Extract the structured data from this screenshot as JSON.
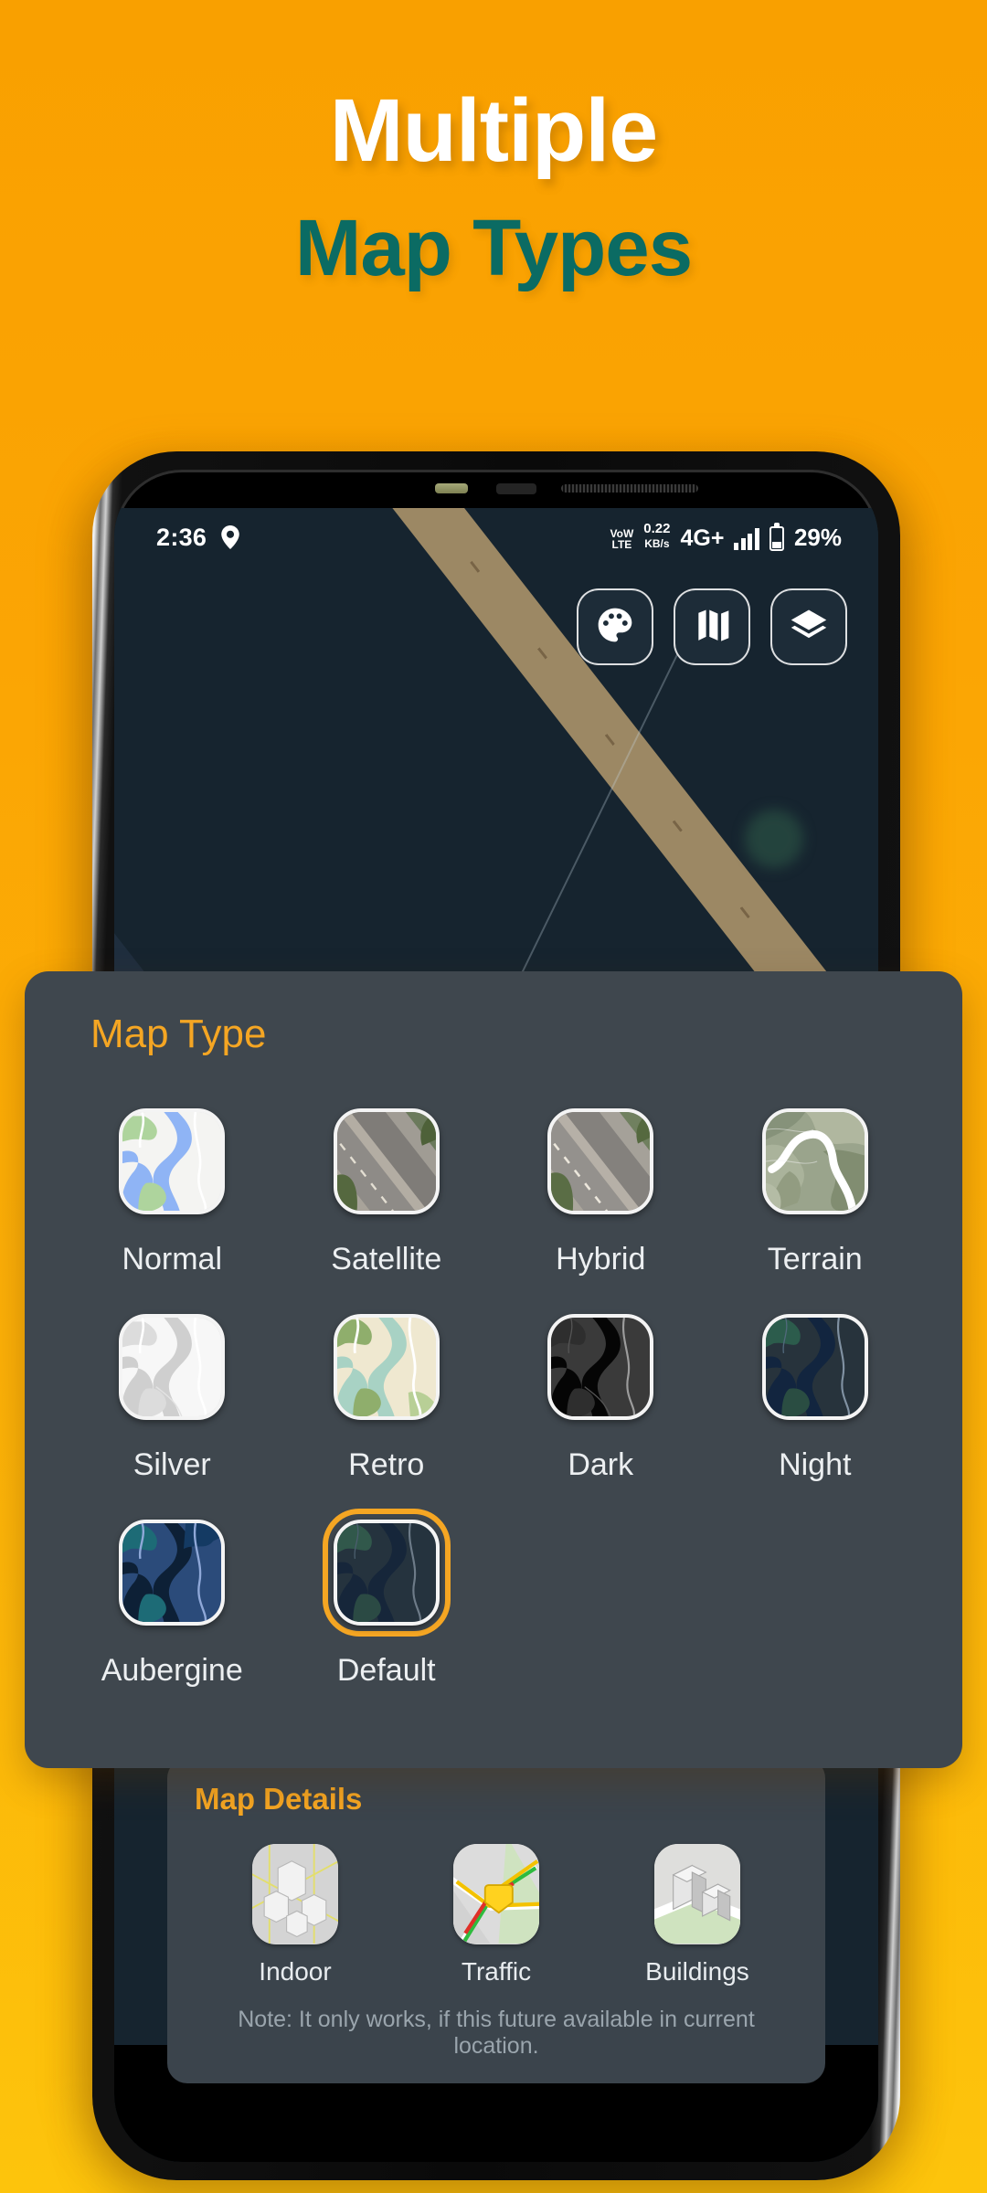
{
  "promo": {
    "line1": "Multiple",
    "line2": "Map Types",
    "line1_color": "#ffffff",
    "line2_color": "#0B6B63",
    "background_color": "#F9A000"
  },
  "status_bar": {
    "clock": "2:36",
    "location_icon": "location-pin-icon",
    "volte_line1": "VoW",
    "volte_line2": "LTE",
    "net_speed_value": "0.22",
    "net_speed_unit": "KB/s",
    "network_type": "4G+",
    "signal_icon": "signal-bars-icon",
    "battery_icon": "battery-icon",
    "battery_percent": "29%"
  },
  "map_controls": [
    {
      "name": "palette-icon",
      "label": "Map Style"
    },
    {
      "name": "folded-map-icon",
      "label": "Map Type"
    },
    {
      "name": "layers-icon",
      "label": "Layers"
    }
  ],
  "map_type_sheet": {
    "title": "Map Type",
    "selected": "Default",
    "accent_color": "#F5A623",
    "sheet_color": "#3F474E",
    "items": [
      {
        "label": "Normal",
        "selected": false
      },
      {
        "label": "Satellite",
        "selected": false
      },
      {
        "label": "Hybrid",
        "selected": false
      },
      {
        "label": "Terrain",
        "selected": false
      },
      {
        "label": "Silver",
        "selected": false
      },
      {
        "label": "Retro",
        "selected": false
      },
      {
        "label": "Dark",
        "selected": false
      },
      {
        "label": "Night",
        "selected": false
      },
      {
        "label": "Aubergine",
        "selected": false
      },
      {
        "label": "Default",
        "selected": true
      }
    ]
  },
  "map_details": {
    "title": "Map Details",
    "items": [
      {
        "label": "Indoor"
      },
      {
        "label": "Traffic"
      },
      {
        "label": "Buildings"
      }
    ],
    "note": "Note: It only works, if this future available in current location."
  }
}
